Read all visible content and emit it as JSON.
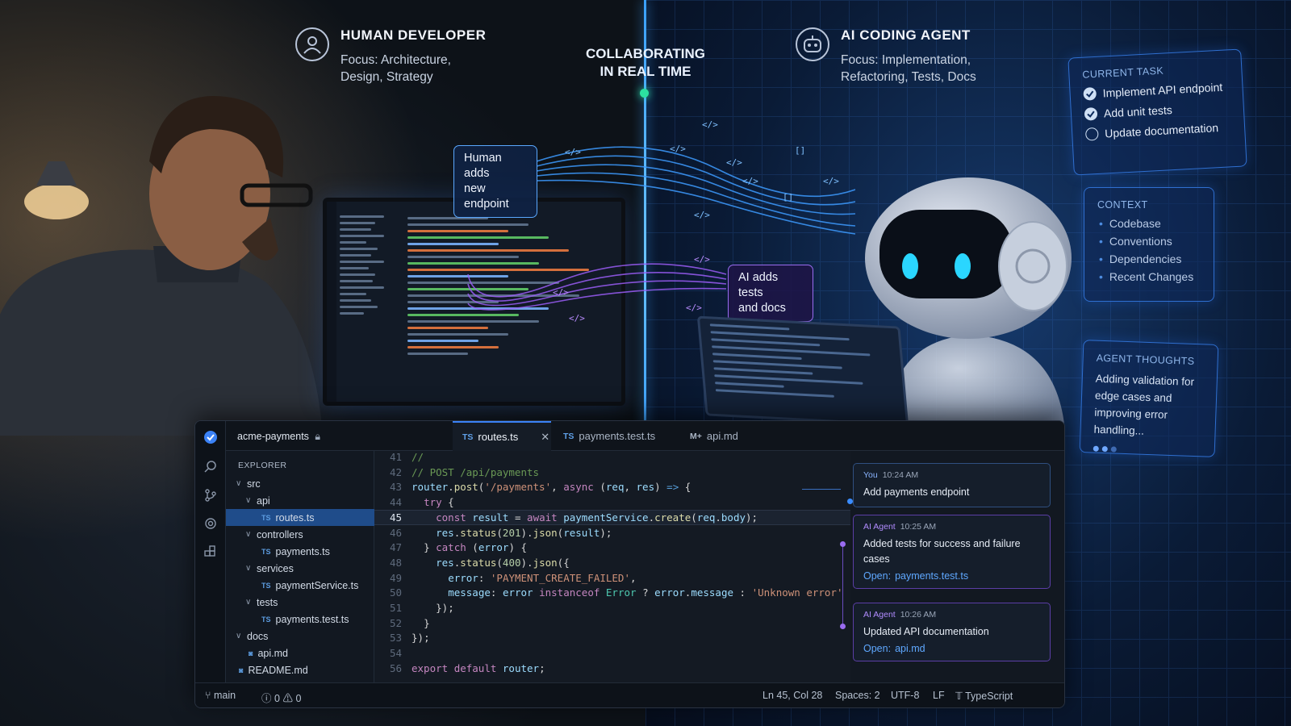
{
  "header": {
    "human": {
      "title": "HUMAN DEVELOPER",
      "focus": "Focus: Architecture,\nDesign, Strategy",
      "icon": "user-icon"
    },
    "center": {
      "title": "COLLABORATING\nIN REAL TIME"
    },
    "agent": {
      "title": "AI CODING AGENT",
      "focus": "Focus: Implementation,\nRefactoring, Tests, Docs",
      "icon": "robot-icon"
    }
  },
  "callouts": {
    "human": "Human adds\nnew endpoint",
    "ai": "AI adds tests\nand docs"
  },
  "panels": {
    "current_task": {
      "title": "CURRENT TASK",
      "items": [
        {
          "label": "Implement API endpoint",
          "done": true
        },
        {
          "label": "Add unit tests",
          "done": true
        },
        {
          "label": "Update documentation",
          "done": false
        }
      ]
    },
    "context": {
      "title": "CONTEXT",
      "items": [
        "Codebase",
        "Conventions",
        "Dependencies",
        "Recent Changes"
      ]
    },
    "thoughts": {
      "title": "AGENT THOUGHTS",
      "text": "Adding validation for edge cases and improving error handling..."
    }
  },
  "ide": {
    "repo": "acme-payments",
    "tabs": [
      {
        "type": "TS",
        "label": "routes.ts",
        "active": true
      },
      {
        "type": "TS",
        "label": "payments.test.ts",
        "active": false
      },
      {
        "type": "M+",
        "label": "api.md",
        "active": false
      }
    ],
    "explorer": {
      "title": "EXPLORER",
      "tree": [
        {
          "label": "src",
          "kind": "folder",
          "depth": 0
        },
        {
          "label": "api",
          "kind": "folder",
          "depth": 1
        },
        {
          "label": "routes.ts",
          "kind": "ts",
          "depth": 2,
          "selected": true
        },
        {
          "label": "controllers",
          "kind": "folder",
          "depth": 1
        },
        {
          "label": "payments.ts",
          "kind": "ts",
          "depth": 2
        },
        {
          "label": "services",
          "kind": "folder",
          "depth": 1
        },
        {
          "label": "paymentService.ts",
          "kind": "ts",
          "depth": 2
        },
        {
          "label": "tests",
          "kind": "folder",
          "depth": 1
        },
        {
          "label": "payments.test.ts",
          "kind": "ts",
          "depth": 2
        },
        {
          "label": "docs",
          "kind": "folder",
          "depth": 0
        },
        {
          "label": "api.md",
          "kind": "md",
          "depth": 1
        },
        {
          "label": "README.md",
          "kind": "md",
          "depth": 0
        }
      ]
    },
    "code": [
      {
        "n": "41",
        "text": "//"
      },
      {
        "n": "42",
        "text": "// POST /api/payments"
      },
      {
        "n": "43",
        "text": "router.post('/payments', async (req, res) => {"
      },
      {
        "n": "44",
        "text": "  try {"
      },
      {
        "n": "45",
        "text": "    const result = await paymentService.create(req.body);"
      },
      {
        "n": "46",
        "text": "    res.status(201).json(result);"
      },
      {
        "n": "47",
        "text": "  } catch (error) {"
      },
      {
        "n": "48",
        "text": "    res.status(400).json({"
      },
      {
        "n": "49",
        "text": "      error: 'PAYMENT_CREATE_FAILED',"
      },
      {
        "n": "50",
        "text": "      message: error instanceof Error ? error.message : 'Unknown error'"
      },
      {
        "n": "51",
        "text": "    });"
      },
      {
        "n": "52",
        "text": "  }"
      },
      {
        "n": "53",
        "text": "});"
      },
      {
        "n": "54",
        "text": ""
      },
      {
        "n": "56",
        "text": "export default router;"
      }
    ],
    "timeline": [
      {
        "author": "You",
        "time": "10:24 AM",
        "text": "Add payments endpoint",
        "open_label": "",
        "open_file": ""
      },
      {
        "author": "AI Agent",
        "time": "10:25 AM",
        "text": "Added tests for success and failure cases",
        "open_label": "Open:",
        "open_file": "payments.test.ts"
      },
      {
        "author": "AI Agent",
        "time": "10:26 AM",
        "text": "Updated API documentation",
        "open_label": "Open:",
        "open_file": "api.md"
      }
    ],
    "status": {
      "branch": "main",
      "errors": "0",
      "warnings": "0",
      "position": "Ln 45, Col 28",
      "spaces": "Spaces: 2",
      "encoding": "UTF-8",
      "eol": "LF",
      "language": "TypeScript"
    }
  },
  "colors": {
    "accent": "#3b82f6",
    "agent": "#9a6cf0",
    "live": "#2ce0a0"
  }
}
